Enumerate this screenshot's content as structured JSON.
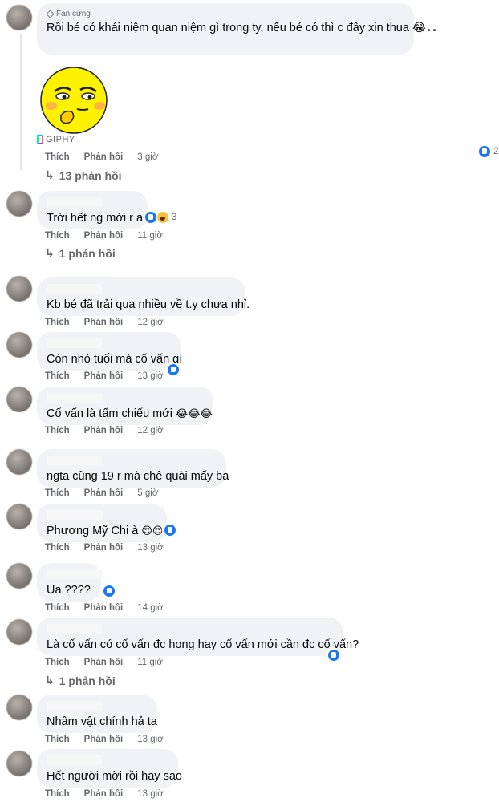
{
  "labels": {
    "like": "Thích",
    "reply": "Phản hồi"
  },
  "comments": [
    {
      "badge": "Fan cứng",
      "text": "Rồi bé có khái niệm quan niệm gì trong ty, nếu bé có thì c đây xin thua 😂",
      "time": "3 giờ",
      "reaction_count": "2",
      "gif_label": "GIPHY",
      "replies_label": "13 phản hồi"
    },
    {
      "text": "Trời hết ng mời r ak",
      "time": "11 giờ",
      "reaction_count": "3",
      "replies_label": "1 phản hồi"
    },
    {
      "text": "Kb bé đã trải qua nhiều về t.y chưa nhỉ.",
      "time": "12 giờ"
    },
    {
      "text": "Còn nhỏ tuổi mà cố vấn gì",
      "time": "13 giờ"
    },
    {
      "text": "Cố vấn là tấm chiếu mới",
      "emoji": "😂😂😂",
      "time": "12 giờ"
    },
    {
      "text": "ngta cũng 19 r mà chê quài mấy ba",
      "time": "5 giờ"
    },
    {
      "text": "Phương Mỹ Chi à",
      "emoji": "😍😍",
      "time": "13 giờ"
    },
    {
      "text": "Ua ????",
      "time": "14 giờ"
    },
    {
      "text": "Là cố vấn có cố vấn đc hong hay cố vấn mới cần đc cố vấn?",
      "time": "11 giờ",
      "replies_label": "1 phản hồi"
    },
    {
      "text": "Nhâm vật chính hả ta",
      "time": "13 giờ"
    },
    {
      "text": "Hết người mời rồi hay sao",
      "time": "13 giờ"
    }
  ],
  "colors": {
    "bubble": "#f0f2f5",
    "meta": "#65676b",
    "like": "#1877f2",
    "thread": "#e4e6eb"
  },
  "icons": {
    "like": "like-icon",
    "haha": "haha-icon",
    "more": "more-options-icon",
    "reply_arrow": "reply-arrow-icon"
  }
}
